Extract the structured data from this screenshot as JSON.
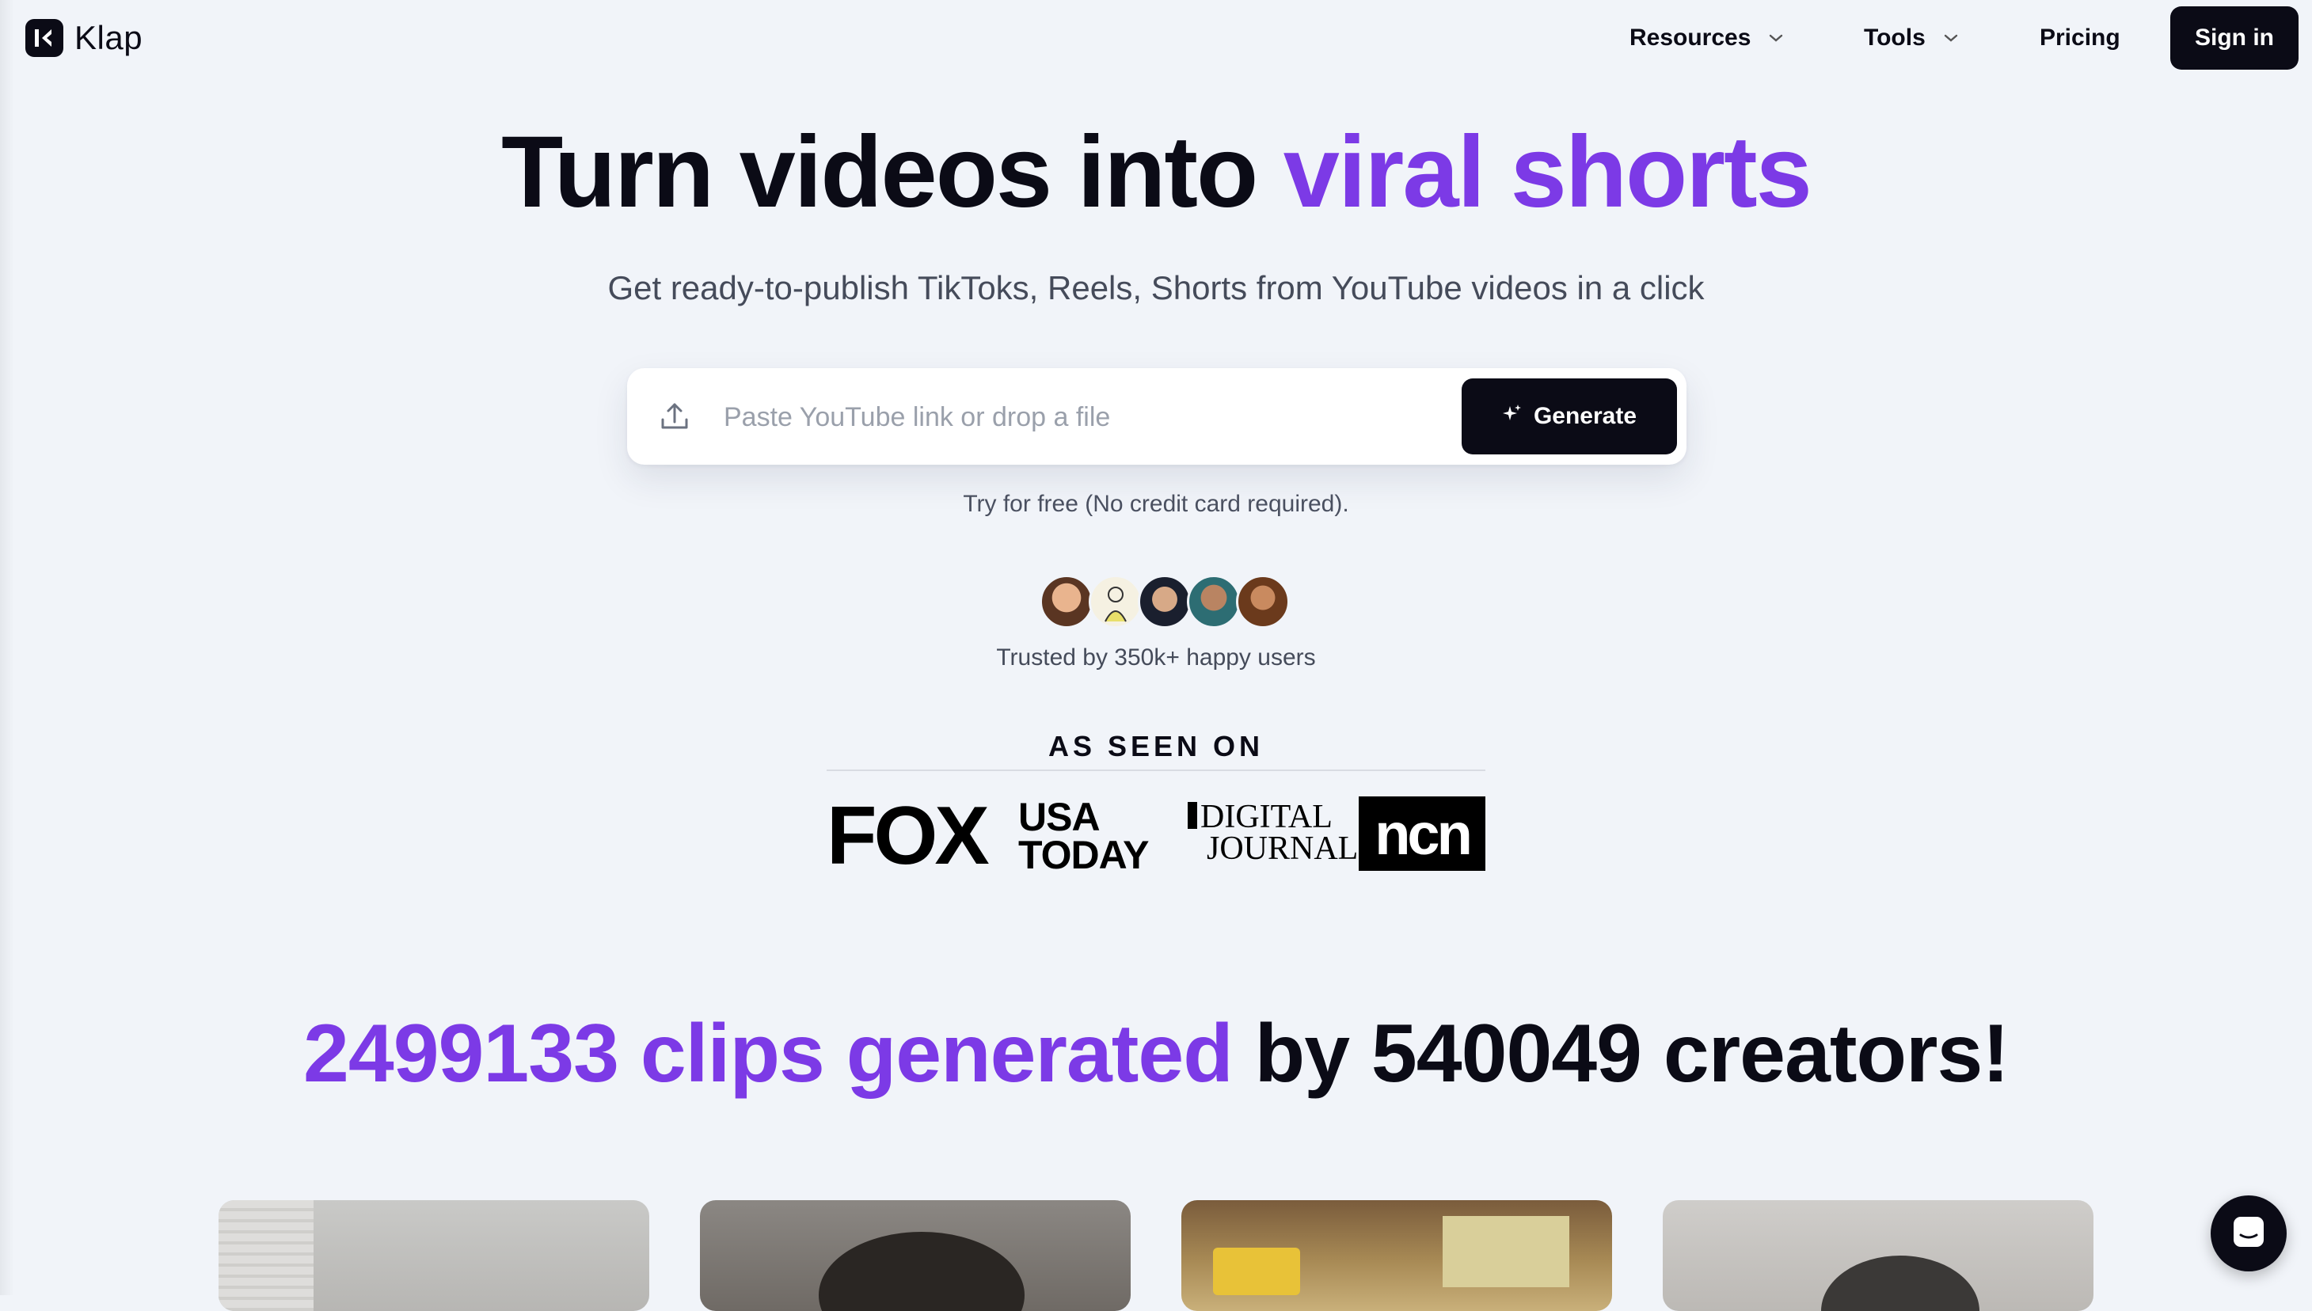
{
  "nav": {
    "brand": "Klap",
    "resources_label": "Resources",
    "tools_label": "Tools",
    "pricing_label": "Pricing",
    "signin_label": "Sign in"
  },
  "hero": {
    "title_dark": "Turn videos into ",
    "title_accent": "viral shorts",
    "subtitle": "Get ready-to-publish TikToks, Reels, Shorts from YouTube videos in a click",
    "input_placeholder": "Paste YouTube link or drop a file",
    "input_value": "",
    "generate_label": "Generate",
    "free_note": "Try for free (No credit card required).",
    "trusted_text": "Trusted by 350k+ happy users",
    "avatar_count": 5
  },
  "seen_on": {
    "title": "AS SEEN ON",
    "logos": {
      "fox": "FOX",
      "usa_line1": "USA",
      "usa_line2": "TODAY",
      "dj_line1": "DIGITAL",
      "dj_line2": "JOURNAL",
      "ncn": "ncn"
    }
  },
  "stats": {
    "clips_count": "2499133",
    "clips_label": " clips generated",
    "by_label": " by ",
    "creators_count": "540049",
    "creators_label": " creators!"
  },
  "colors": {
    "background": "#f1f4f9",
    "primary_dark": "#0b0b16",
    "accent_purple": "#7c3ae6",
    "muted_text": "#454b5a"
  },
  "icons": {
    "upload": "upload-icon",
    "sparkle": "sparkle-icon",
    "chevron": "chevron-down-icon",
    "chat": "chat-icon"
  }
}
